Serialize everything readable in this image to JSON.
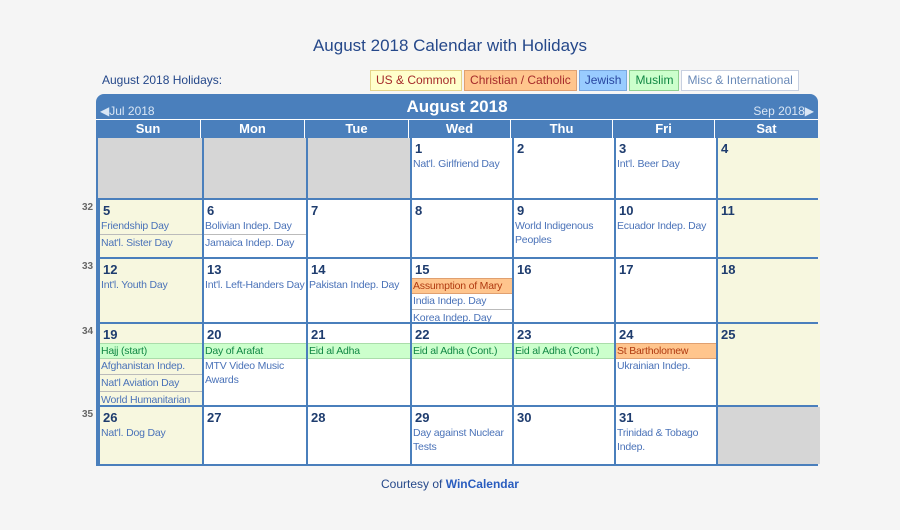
{
  "title": "August 2018 Calendar with Holidays",
  "holidays_label": "August 2018 Holidays:",
  "legend": [
    {
      "label": "US & Common",
      "category": "us",
      "bg": "#ffffcc",
      "color": "#a52a2a"
    },
    {
      "label": "Christian / Catholic",
      "category": "christian",
      "bg": "#ffc58d",
      "color": "#a52a2a"
    },
    {
      "label": "Jewish",
      "category": "jewish",
      "bg": "#99ccff",
      "color": "#2846a0"
    },
    {
      "label": "Muslim",
      "category": "muslim",
      "bg": "#ccffcc",
      "color": "#118844"
    },
    {
      "label": "Misc & International",
      "category": "misc",
      "bg": "#ffffff",
      "color": "#6a8ab8"
    }
  ],
  "calendar": {
    "prev_label": "◀Jul 2018",
    "next_label": "Sep 2018▶",
    "month_label": "August 2018",
    "weekdays": [
      "Sun",
      "Mon",
      "Tue",
      "Wed",
      "Thu",
      "Fri",
      "Sat"
    ],
    "weeks": [
      {
        "week_number": "",
        "days": [
          {
            "num": "",
            "empty": true,
            "events": []
          },
          {
            "num": "",
            "empty": true,
            "events": []
          },
          {
            "num": "",
            "empty": true,
            "events": []
          },
          {
            "num": "1",
            "events": [
              {
                "text": "Nat'l. Girlfriend Day",
                "type": "misc"
              }
            ]
          },
          {
            "num": "2",
            "events": []
          },
          {
            "num": "3",
            "events": [
              {
                "text": "Int'l. Beer Day",
                "type": "misc"
              }
            ]
          },
          {
            "num": "4",
            "weekend": true,
            "events": []
          }
        ]
      },
      {
        "week_number": "32",
        "days": [
          {
            "num": "5",
            "weekend": true,
            "events": [
              {
                "text": "Friendship Day",
                "type": "misc"
              },
              {
                "text": "Nat'l. Sister Day",
                "type": "misc"
              }
            ]
          },
          {
            "num": "6",
            "events": [
              {
                "text": "Bolivian Indep. Day",
                "type": "misc"
              },
              {
                "text": "Jamaica Indep. Day",
                "type": "misc"
              }
            ]
          },
          {
            "num": "7",
            "events": []
          },
          {
            "num": "8",
            "events": []
          },
          {
            "num": "9",
            "events": [
              {
                "text": "World Indigenous Peoples",
                "type": "misc"
              }
            ]
          },
          {
            "num": "10",
            "events": [
              {
                "text": "Ecuador Indep. Day",
                "type": "misc"
              }
            ]
          },
          {
            "num": "11",
            "weekend": true,
            "events": []
          }
        ]
      },
      {
        "week_number": "33",
        "days": [
          {
            "num": "12",
            "weekend": true,
            "events": [
              {
                "text": "Int'l. Youth Day",
                "type": "misc"
              }
            ]
          },
          {
            "num": "13",
            "events": [
              {
                "text": "Int'l. Left-Handers Day",
                "type": "misc"
              }
            ]
          },
          {
            "num": "14",
            "events": [
              {
                "text": "Pakistan Indep. Day",
                "type": "misc"
              }
            ]
          },
          {
            "num": "15",
            "events": [
              {
                "text": "Assumption of Mary",
                "type": "christian"
              },
              {
                "text": "India Indep. Day",
                "type": "misc"
              },
              {
                "text": "Korea Indep. Day",
                "type": "misc"
              }
            ]
          },
          {
            "num": "16",
            "events": []
          },
          {
            "num": "17",
            "events": []
          },
          {
            "num": "18",
            "weekend": true,
            "events": []
          }
        ]
      },
      {
        "week_number": "34",
        "days": [
          {
            "num": "19",
            "weekend": true,
            "events": [
              {
                "text": "Hajj (start)",
                "type": "muslim"
              },
              {
                "text": "Afghanistan Indep.",
                "type": "misc"
              },
              {
                "text": "Nat'l Aviation Day",
                "type": "misc"
              },
              {
                "text": "World Humanitarian",
                "type": "misc"
              }
            ]
          },
          {
            "num": "20",
            "events": [
              {
                "text": "Day of Arafat",
                "type": "muslim"
              },
              {
                "text": "MTV Video Music Awards",
                "type": "misc"
              }
            ]
          },
          {
            "num": "21",
            "events": [
              {
                "text": "Eid al Adha",
                "type": "muslim"
              }
            ]
          },
          {
            "num": "22",
            "events": [
              {
                "text": "Eid al Adha (Cont.)",
                "type": "muslim"
              }
            ]
          },
          {
            "num": "23",
            "events": [
              {
                "text": "Eid al Adha (Cont.)",
                "type": "muslim"
              }
            ]
          },
          {
            "num": "24",
            "events": [
              {
                "text": "St Bartholomew",
                "type": "christian"
              },
              {
                "text": "Ukrainian Indep.",
                "type": "misc"
              }
            ]
          },
          {
            "num": "25",
            "weekend": true,
            "events": []
          }
        ]
      },
      {
        "week_number": "35",
        "days": [
          {
            "num": "26",
            "weekend": true,
            "events": [
              {
                "text": "Nat'l. Dog Day",
                "type": "misc"
              }
            ]
          },
          {
            "num": "27",
            "events": []
          },
          {
            "num": "28",
            "events": []
          },
          {
            "num": "29",
            "events": [
              {
                "text": "Day against Nuclear Tests",
                "type": "misc"
              }
            ]
          },
          {
            "num": "30",
            "events": []
          },
          {
            "num": "31",
            "events": [
              {
                "text": "Trinidad & Tobago Indep.",
                "type": "misc"
              }
            ]
          },
          {
            "num": "",
            "empty": true,
            "events": []
          }
        ]
      }
    ]
  },
  "footer": {
    "prefix": "Courtesy of ",
    "link": "WinCalendar"
  },
  "colors": {
    "header_blue": "#4a7fbc",
    "weekend_bg": "#f7f7df",
    "empty_bg": "#d6d6d6",
    "text_navy": "#25488a"
  }
}
